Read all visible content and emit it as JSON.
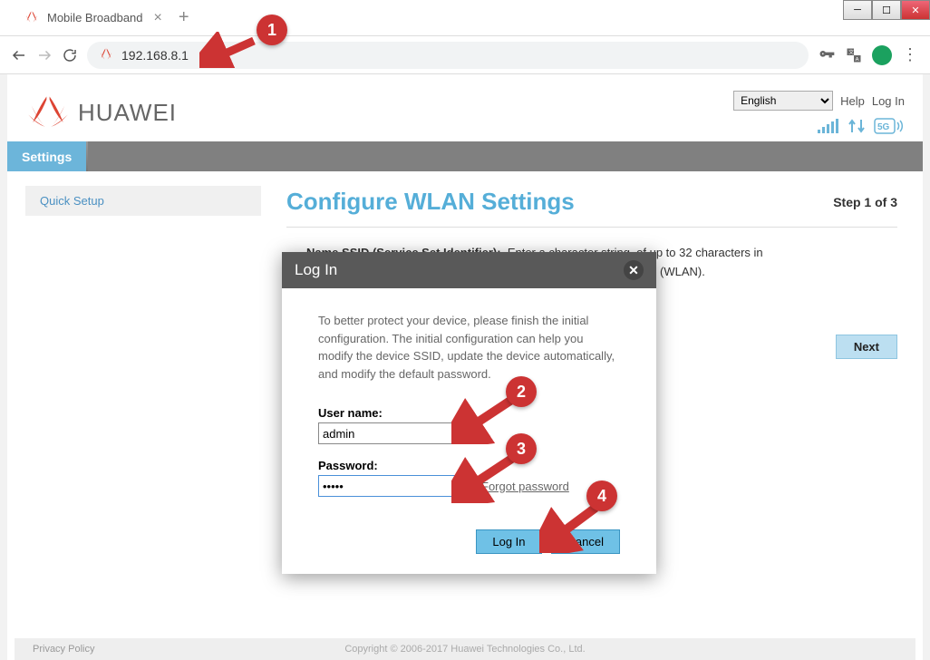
{
  "window": {
    "tab_title": "Mobile Broadband",
    "url": "192.168.8.1"
  },
  "header": {
    "brand": "HUAWEI",
    "language": "English",
    "help_label": "Help",
    "login_label": "Log In"
  },
  "nav": {
    "settings": "Settings"
  },
  "sidebar": {
    "quick_setup": "Quick Setup"
  },
  "main": {
    "title": "Configure WLAN Settings",
    "step": "Step 1 of 3",
    "ssid_label": "Name SSID (Service Set Identifier):",
    "ssid_desc_1": "Enter a character string, of up to 32 characters in",
    "ssid_desc_2": "(WLAN).",
    "next_label": "Next"
  },
  "modal": {
    "title": "Log In",
    "message": "To better protect your device, please finish the initial configuration. The initial configuration can help you modify the device SSID, update the device automatically, and modify the default password.",
    "username_label": "User name:",
    "username_value": "admin",
    "password_label": "Password:",
    "password_value": "•••••",
    "forgot": "Forgot password",
    "login_btn": "Log In",
    "cancel_btn": "Cancel"
  },
  "annotations": {
    "n1": "1",
    "n2": "2",
    "n3": "3",
    "n4": "4"
  },
  "footer": {
    "privacy": "Privacy Policy",
    "copyright": "Copyright © 2006-2017 Huawei Technologies Co., Ltd."
  }
}
